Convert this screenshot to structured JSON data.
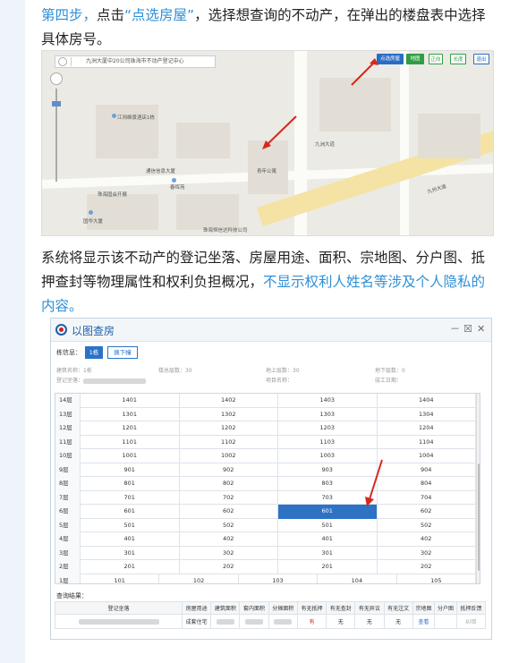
{
  "step4": {
    "prefix": "第四步，",
    "mid1": "点击",
    "link": "“点选房屋”",
    "rest": "，选择想查询的不动产，在弹出的楼盘表中选择具体房号。"
  },
  "map": {
    "search_text": "九洲大厦中20公司珠海市不动产登记中心",
    "buttons": [
      {
        "label": "点选房屋",
        "color": "#2b6cc4"
      },
      {
        "label": "地图",
        "color": "#2f9e44"
      },
      {
        "label": "正向",
        "color": "#ffffff"
      },
      {
        "label": "长度",
        "color": "#ffffff"
      },
      {
        "label": "退出",
        "color": "#ffffff"
      }
    ],
    "labels": {
      "a": "江则维景酒店1栋",
      "b": "通信信息大厦",
      "c": "春晖苑",
      "d": "珠海国会开展",
      "e": "国华大厦",
      "f": "珠海恒信达科技公司",
      "g": "九洲大道",
      "h": "青年公寓",
      "i": "九州大道"
    }
  },
  "step_text": {
    "main": "系统将显示该不动产的登记坐落、房屋用途、面积、宗地图、分户图、抵押查封等物理属性和权利负担概况，",
    "hl": "不显示权利人姓名等涉及个人隐私的内容。"
  },
  "window": {
    "title": "以图查房",
    "ctl_min": "－",
    "ctl_max": "☒",
    "ctl_close": "✕",
    "bld_label": "栋信息：",
    "bld_btn1": "1栋",
    "bld_btn2": "换下幢",
    "info": {
      "name_label": "建筑名称：",
      "name_value": "1栋",
      "total_floors": "楼总层数：30",
      "above": "地上层数：30",
      "below": "地下层数：0",
      "addr_label": "登记坐落：",
      "project": "项目名称：",
      "completion": "竣工日期："
    },
    "floors": [
      {
        "label": "14层",
        "units": [
          "1401",
          "1402",
          "1403",
          "1404"
        ]
      },
      {
        "label": "13层",
        "units": [
          "1301",
          "1302",
          "1303",
          "1304"
        ]
      },
      {
        "label": "12层",
        "units": [
          "1201",
          "1202",
          "1203",
          "1204"
        ]
      },
      {
        "label": "11层",
        "units": [
          "1101",
          "1102",
          "1103",
          "1104"
        ]
      },
      {
        "label": "10层",
        "units": [
          "1001",
          "1002",
          "1003",
          "1004"
        ]
      },
      {
        "label": "9层",
        "units": [
          "901",
          "902",
          "903",
          "904"
        ]
      },
      {
        "label": "8层",
        "units": [
          "801",
          "802",
          "803",
          "804"
        ]
      },
      {
        "label": "7层",
        "units": [
          "701",
          "702",
          "703",
          "704"
        ]
      },
      {
        "label": "6层",
        "units": [
          "601",
          "602",
          "601",
          "602"
        ]
      },
      {
        "label": "5层",
        "units": [
          "501",
          "502",
          "501",
          "502"
        ]
      },
      {
        "label": "4层",
        "units": [
          "401",
          "402",
          "401",
          "402"
        ]
      },
      {
        "label": "3层",
        "units": [
          "301",
          "302",
          "301",
          "302"
        ]
      },
      {
        "label": "2层",
        "units": [
          "201",
          "202",
          "201",
          "202"
        ]
      },
      {
        "label": "1层",
        "units": [
          "101",
          "102",
          "103",
          "104",
          "105"
        ]
      }
    ],
    "selected_unit": "601",
    "results_label": "查询结果：",
    "results_headers": [
      "登记坐落",
      "房屋用途",
      "建筑面积",
      "套内面积",
      "分摊面积",
      "有无抵押",
      "有无查封",
      "有无异议",
      "有无注文",
      "宗地图",
      "分户图",
      "抵押反馈"
    ],
    "results_row": {
      "use": "成套住宅",
      "mortgage": "有",
      "seal": "无",
      "objection": "无",
      "note": "无",
      "parcel": "查看",
      "feedback": "纠错"
    }
  }
}
